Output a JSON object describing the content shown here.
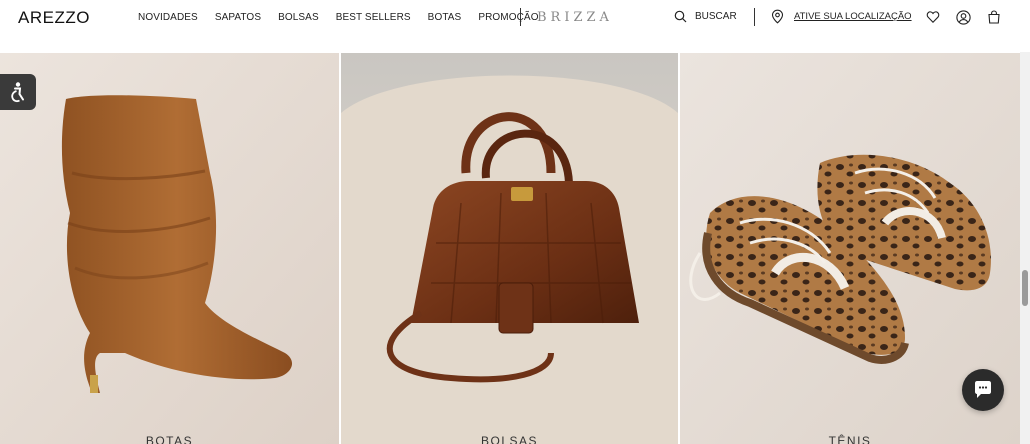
{
  "header": {
    "logo": "AREZZO",
    "nav": [
      "NOVIDADES",
      "SAPATOS",
      "BOLSAS",
      "BEST SELLERS",
      "BOTAS",
      "PROMOÇÃO"
    ],
    "secondary_brand": "BRIZZA",
    "search_label": "BUSCAR",
    "location_label": "ATIVE SUA LOCALIZAÇÃO",
    "icons": [
      "search-icon",
      "location-pin-icon",
      "heart-icon",
      "user-icon",
      "bag-icon"
    ]
  },
  "tiles": [
    {
      "label": "BOTAS",
      "background": "#e8ded6",
      "product": "suede-boot"
    },
    {
      "label": "BOLSAS",
      "background": "#d9d0c6",
      "product": "croc-handbag"
    },
    {
      "label": "TÊNIS",
      "background": "#e6ded7",
      "product": "leopard-sneakers"
    }
  ],
  "widgets": {
    "accessibility_icon": "accessibility-icon",
    "chat_icon": "chat-bubble-icon"
  },
  "colors": {
    "boot": "#a8642f",
    "bag": "#7a3a1c",
    "sneaker_spots": "#3a2518",
    "sneaker_base": "#b07a45",
    "widget_dark": "#2b2b2b"
  }
}
